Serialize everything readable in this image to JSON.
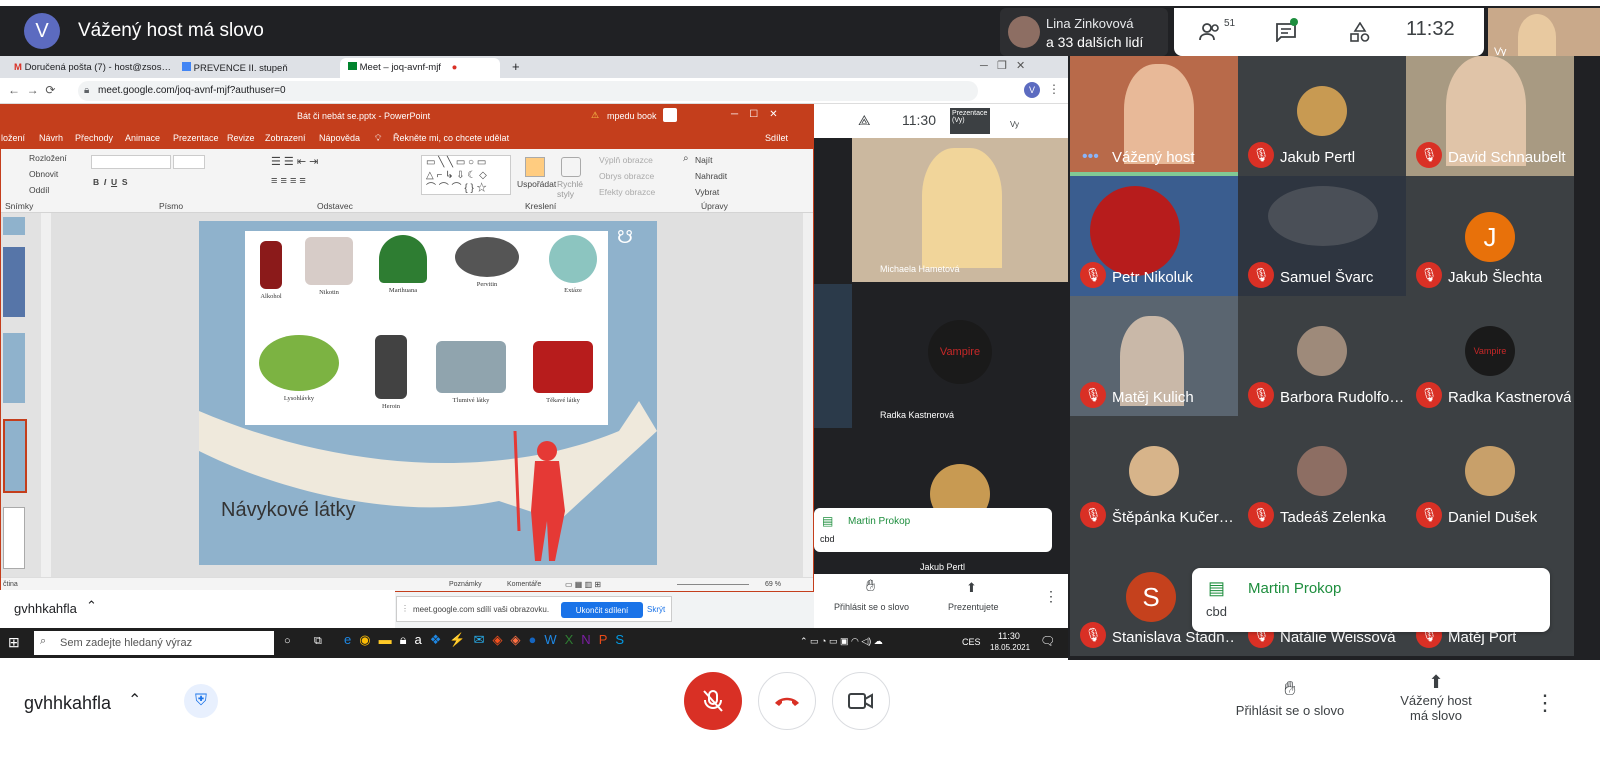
{
  "topbar": {
    "avatar_letter": "V",
    "title": "Vážený host má slovo",
    "people_line1": "Lina Zinkovová",
    "people_line2": "a 33 dalších lidí",
    "participants_count": "51",
    "clock": "11:32",
    "self_label": "Vy"
  },
  "browser": {
    "tabs": [
      "Doručená pošta (7) - host@zsos…",
      "PREVENCE II. stupeň",
      "Meet – joq-avnf-mjf"
    ],
    "url": "meet.google.com/joq-avnf-mjf?authuser=0",
    "profile_letter": "V"
  },
  "ppt": {
    "title": "Bát či nebát se.pptx  -  PowerPoint",
    "warning": "mpedu book",
    "menu": [
      "ložení",
      "Návrh",
      "Přechody",
      "Animace",
      "Prezentace",
      "Revize",
      "Zobrazení",
      "Nápověda",
      "Řekněte mi, co chcete udělat",
      "Sdílet"
    ],
    "ribbon": {
      "layout": "Rozložení",
      "reset": "Obnovit",
      "section": "Oddíl",
      "group_slides": "Snímky",
      "group_font": "Písmo",
      "group_paragraph": "Odstavec",
      "group_drawing": "Kreslení",
      "group_edit": "Úpravy",
      "arrange": "Uspořádat",
      "quick_styles": "Rychlé styly",
      "shape_fill": "Výplň obrazce",
      "shape_outline": "Obrys obrazce",
      "shape_effects": "Efekty obrazce",
      "find": "Najít",
      "replace": "Nahradit",
      "select": "Vybrat"
    },
    "slide": {
      "title": "Návykové látky",
      "items": [
        "Alkohol",
        "Nikotin",
        "Marihuana",
        "Pervitin",
        "Extáze",
        "Lysohlávky",
        "Heroin",
        "Tlumivé látky",
        "Těkavé látky"
      ]
    },
    "status": {
      "lang": "čtina",
      "notes": "Poznámky",
      "comments": "Komentáře",
      "zoom": "69 %"
    }
  },
  "inner_meet": {
    "clock": "11:30",
    "presenting": "Prezentace (Vy)",
    "self": "Vy",
    "tile1": "Michaela Hametová",
    "tile2": "Radka Kastnerová",
    "tile3": "Jakub Pertl",
    "chat_name": "Martin Prokop",
    "chat_msg": "cbd",
    "raise": "Přihlásit se o slovo",
    "presenting_btn": "Prezentujete"
  },
  "share_banner": {
    "text": "meet.google.com sdílí vaši obrazovku.",
    "stop": "Ukončit sdílení",
    "hide": "Skrýt"
  },
  "download_bar": {
    "code": "gvhhkahfla"
  },
  "taskbar": {
    "search": "Sem zadejte hledaný výraz",
    "lang": "CES",
    "time": "11:30",
    "date": "18.05.2021"
  },
  "grid": [
    {
      "name": "Vážený host",
      "color": "#b86a4a",
      "muted": false
    },
    {
      "name": "Jakub Pertl",
      "color": "#3c4043",
      "muted": true
    },
    {
      "name": "David Schnaubelt",
      "color": "#a89a82",
      "muted": true
    },
    {
      "name": "Petr Nikoluk",
      "color": "#3a5d8f",
      "muted": true
    },
    {
      "name": "Samuel Švarc",
      "color": "#2e3540",
      "muted": true
    },
    {
      "name": "Jakub Šlechta",
      "color": "#3c4043",
      "muted": true
    },
    {
      "name": "Matěj Kulich",
      "color": "#5a6570",
      "muted": true
    },
    {
      "name": "Barbora Rudolfo…",
      "color": "#3c4043",
      "muted": true
    },
    {
      "name": "Radka Kastnerová",
      "color": "#3c4043",
      "muted": true
    },
    {
      "name": "Štěpánka Kučer…",
      "color": "#3c4043",
      "muted": true
    },
    {
      "name": "Tadeáš Zelenka",
      "color": "#3c4043",
      "muted": true
    },
    {
      "name": "Daniel Dušek",
      "color": "#3c4043",
      "muted": true
    },
    {
      "name": "Stanislava Stadn…",
      "color": "#3c4043",
      "muted": true
    },
    {
      "name": "Natálie Weissová",
      "color": "#3c4043",
      "muted": true
    },
    {
      "name": "Matěj Port",
      "color": "#3c4043",
      "muted": true
    }
  ],
  "avatars": {
    "jakub_letter": "J",
    "stanislava_letter": "S"
  },
  "chat": {
    "name": "Martin Prokop",
    "message": "cbd"
  },
  "bottombar": {
    "meeting_code": "gvhhkahfla",
    "raise_hand": "Přihlásit se o slovo",
    "presenting_l1": "Vážený host",
    "presenting_l2": "má slovo"
  }
}
